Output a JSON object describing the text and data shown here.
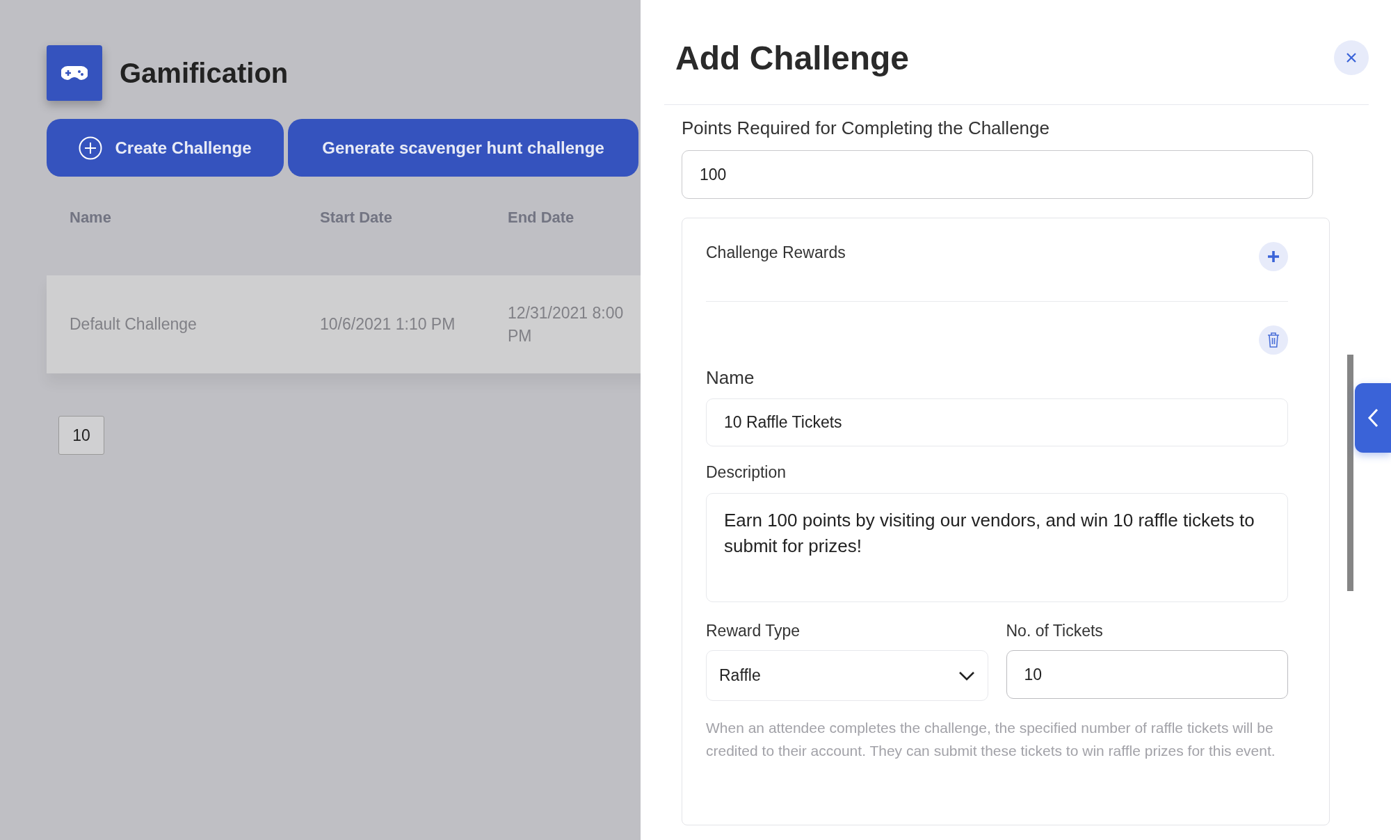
{
  "page": {
    "title": "Gamification",
    "buttons": [
      {
        "kind": "add",
        "label": "Create Challenge"
      },
      {
        "kind": "plain",
        "label": "Generate scavenger hunt challenge"
      }
    ],
    "table": {
      "columns": [
        "Name",
        "Start Date",
        "End Date"
      ],
      "rows": [
        [
          "Default Challenge",
          "10/6/2021 1:10 PM",
          "12/31/2021 8:00 PM"
        ]
      ]
    },
    "page_size": "10"
  },
  "panel": {
    "title": "Add Challenge",
    "points": {
      "label": "Points Required for Completing the Challenge",
      "value": "100"
    },
    "rewards": {
      "title": "Challenge Rewards",
      "items": [
        {
          "name_label": "Name",
          "name": "10 Raffle Tickets",
          "description_label": "Description",
          "description": "Earn 100 points by visiting our vendors, and win 10 raffle tickets to submit for prizes!",
          "type_label": "Reward Type",
          "type": "Raffle",
          "tickets_label": "No. of Tickets",
          "tickets": "10",
          "help": "When an attendee completes the challenge, the specified number of raffle tickets will be credited to their account. They can submit these tickets to win raffle prizes for this event."
        }
      ]
    }
  }
}
